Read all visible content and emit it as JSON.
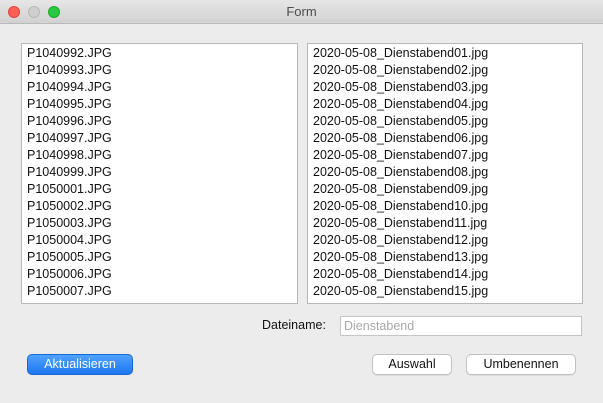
{
  "window": {
    "title": "Form"
  },
  "left_list": {
    "items": [
      "P1040992.JPG",
      "P1040993.JPG",
      "P1040994.JPG",
      "P1040995.JPG",
      "P1040996.JPG",
      "P1040997.JPG",
      "P1040998.JPG",
      "P1040999.JPG",
      "P1050001.JPG",
      "P1050002.JPG",
      "P1050003.JPG",
      "P1050004.JPG",
      "P1050005.JPG",
      "P1050006.JPG",
      "P1050007.JPG"
    ]
  },
  "right_list": {
    "items": [
      "2020-05-08_Dienstabend01.jpg",
      "2020-05-08_Dienstabend02.jpg",
      "2020-05-08_Dienstabend03.jpg",
      "2020-05-08_Dienstabend04.jpg",
      "2020-05-08_Dienstabend05.jpg",
      "2020-05-08_Dienstabend06.jpg",
      "2020-05-08_Dienstabend07.jpg",
      "2020-05-08_Dienstabend08.jpg",
      "2020-05-08_Dienstabend09.jpg",
      "2020-05-08_Dienstabend10.jpg",
      "2020-05-08_Dienstabend11.jpg",
      "2020-05-08_Dienstabend12.jpg",
      "2020-05-08_Dienstabend13.jpg",
      "2020-05-08_Dienstabend14.jpg",
      "2020-05-08_Dienstabend15.jpg"
    ]
  },
  "filename": {
    "label": "Dateiname:",
    "value": "",
    "placeholder": "Dienstabend"
  },
  "buttons": {
    "refresh": "Aktualisieren",
    "select": "Auswahl",
    "rename": "Umbenennen"
  },
  "colors": {
    "close": "#fe5f57",
    "zoom": "#28c840",
    "primary_button": "#1e76f0"
  }
}
